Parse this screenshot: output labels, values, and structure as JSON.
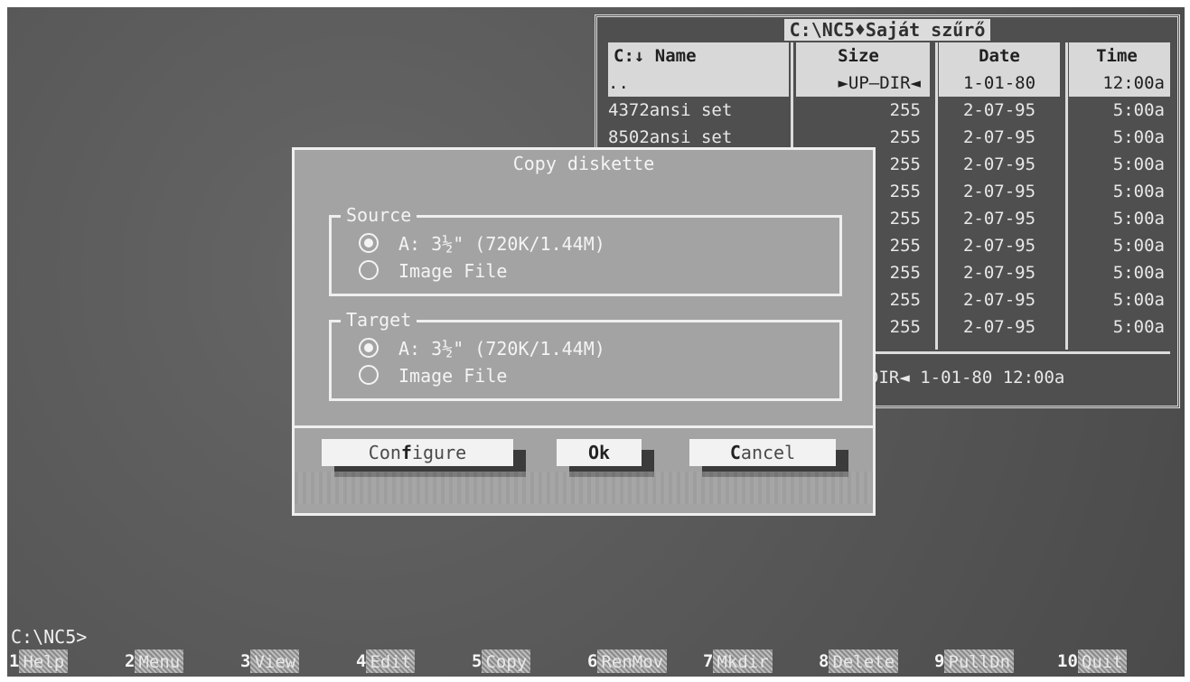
{
  "panel": {
    "title": "C:\\NC5♦Saját szűrő",
    "headers": {
      "name": "C:↓ Name",
      "size": "Size",
      "date": "Date",
      "time": "Time"
    },
    "rows": [
      {
        "name": "..",
        "size": "►UP—DIR◄",
        "date": "1-01-80",
        "time": "12:00a"
      },
      {
        "name": "4372ansi set",
        "size": "255",
        "date": "2-07-95",
        "time": "5:00a"
      },
      {
        "name": "8502ansi set",
        "size": "255",
        "date": "2-07-95",
        "time": "5:00a"
      },
      {
        "name": "",
        "size": "255",
        "date": "2-07-95",
        "time": "5:00a"
      },
      {
        "name": "",
        "size": "255",
        "date": "2-07-95",
        "time": "5:00a"
      },
      {
        "name": "",
        "size": "255",
        "date": "2-07-95",
        "time": "5:00a"
      },
      {
        "name": "",
        "size": "255",
        "date": "2-07-95",
        "time": "5:00a"
      },
      {
        "name": "",
        "size": "255",
        "date": "2-07-95",
        "time": "5:00a"
      },
      {
        "name": "",
        "size": "255",
        "date": "2-07-95",
        "time": "5:00a"
      },
      {
        "name": "",
        "size": "255",
        "date": "2-07-95",
        "time": "5:00a"
      }
    ],
    "status": "DIR◄  1-01-80 12:00a"
  },
  "dialog": {
    "title": "Copy diskette",
    "source": {
      "label": "Source",
      "option1": "A: 3½\" (720K/1.44M)",
      "option2": "Image File",
      "selected": "option1"
    },
    "target": {
      "label": "Target",
      "option1": "A: 3½\" (720K/1.44M)",
      "option2": "Image File",
      "selected": "option1"
    },
    "buttons": {
      "configure_pre": "Con",
      "configure_hot": "f",
      "configure_post": "igure",
      "ok": "Ok",
      "cancel_hot": "C",
      "cancel_post": "ancel"
    }
  },
  "prompt": "C:\\NC5>",
  "fkeys": [
    {
      "num": "1",
      "label": "Help"
    },
    {
      "num": "2",
      "label": "Menu"
    },
    {
      "num": "3",
      "label": "View"
    },
    {
      "num": "4",
      "label": "Edit"
    },
    {
      "num": "5",
      "label": "Copy"
    },
    {
      "num": "6",
      "label": "RenMov"
    },
    {
      "num": "7",
      "label": "Mkdir"
    },
    {
      "num": "8",
      "label": "Delete"
    },
    {
      "num": "9",
      "label": "PullDn"
    },
    {
      "num": "10",
      "label": "Quit"
    }
  ]
}
